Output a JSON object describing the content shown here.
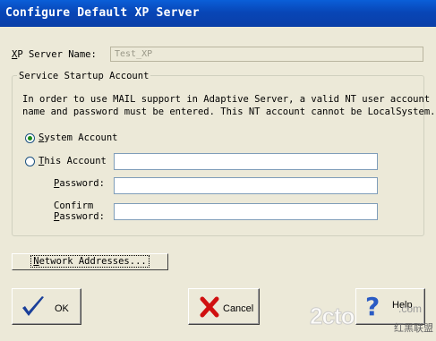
{
  "window": {
    "title": "Configure Default XP Server"
  },
  "server_name": {
    "label": "XP Server Name:",
    "mnemonic": "X",
    "rest": "P Server Name:",
    "value": "Test_XP"
  },
  "startup": {
    "group_label": "Service Startup Account",
    "description_line1": "In order to use MAIL support in Adaptive Server, a valid NT user account",
    "description_line2": "name and password must be entered. This NT account cannot be LocalSystem.",
    "system_account": {
      "mnemonic": "S",
      "rest": "ystem Account",
      "checked": true
    },
    "this_account": {
      "mnemonic": "T",
      "rest": "his Account",
      "checked": false,
      "value": ""
    },
    "password": {
      "mnemonic": "P",
      "rest": "assword:",
      "value": ""
    },
    "confirm": {
      "line1": "Confirm",
      "mnemonic": "P",
      "rest": "assword:",
      "value": ""
    }
  },
  "buttons": {
    "network": {
      "mnemonic": "N",
      "rest": "etwork Addresses..."
    },
    "ok": {
      "label": "OK"
    },
    "cancel": {
      "label": "Cancel"
    },
    "help": {
      "label": "Help"
    }
  },
  "watermark": {
    "brand": "2cto",
    "suffix": ".com",
    "subtitle": "红黑联盟"
  },
  "colors": {
    "titlebar": "#0846b7",
    "check_icon": "#1a3f9a",
    "cancel_icon": "#d01010",
    "help_icon": "#2a5bc4"
  }
}
